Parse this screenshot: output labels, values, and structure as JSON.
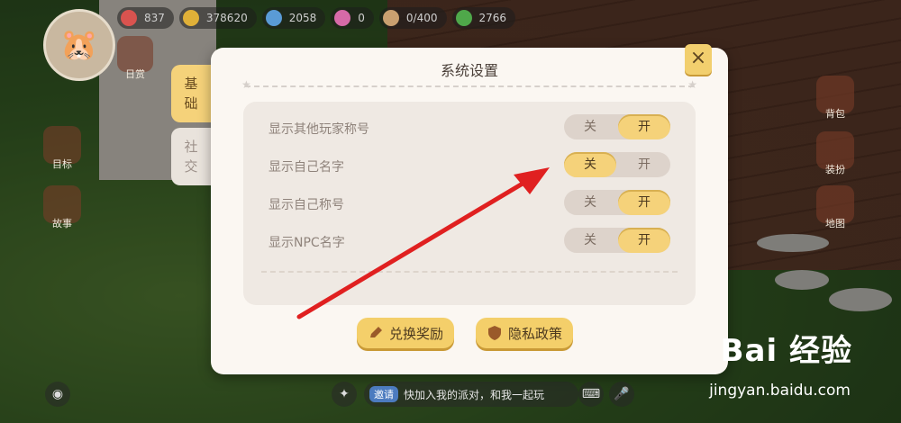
{
  "resources": [
    {
      "icon": "heart-icon",
      "value": "837",
      "color": "#d9534f"
    },
    {
      "icon": "coin-icon",
      "value": "378620",
      "color": "#e0b038"
    },
    {
      "icon": "potion-icon",
      "value": "2058",
      "color": "#5a9bd6"
    },
    {
      "icon": "gem-icon",
      "value": "0",
      "color": "#d66aa8"
    },
    {
      "icon": "hamster-icon",
      "value": "0/400",
      "color": "#c9a070"
    },
    {
      "icon": "clover-icon",
      "value": "2766",
      "color": "#4fa84a"
    }
  ],
  "side_left": [
    {
      "label": "目标"
    },
    {
      "label": "故事"
    }
  ],
  "side_top_left": [
    {
      "label": "日赏"
    }
  ],
  "side_right": [
    {
      "label": "背包"
    },
    {
      "label": "装扮"
    },
    {
      "label": "地图"
    }
  ],
  "modal": {
    "title": "系统设置",
    "close_label": "×",
    "tabs": [
      {
        "label": "基础",
        "active": true
      },
      {
        "label": "社交",
        "active": false
      }
    ],
    "settings": [
      {
        "label": "显示其他玩家称号",
        "off": "关",
        "on": "开",
        "state": "on"
      },
      {
        "label": "显示自己名字",
        "off": "关",
        "on": "开",
        "state": "off"
      },
      {
        "label": "显示自己称号",
        "off": "关",
        "on": "开",
        "state": "on"
      },
      {
        "label": "显示NPC名字",
        "off": "关",
        "on": "开",
        "state": "on"
      }
    ],
    "buttons": [
      {
        "label": "兑换奖励",
        "icon": "pencil-icon"
      },
      {
        "label": "隐私政策",
        "icon": "shield-icon"
      }
    ]
  },
  "chat": {
    "tag": "邀请",
    "text": "快加入我的派对，和我一起玩"
  },
  "watermark": {
    "brand": "Bai 经验",
    "url": "jingyan.baidu.com"
  },
  "colors": {
    "accent": "#f5d27a",
    "modal_bg": "#fbf7f2",
    "panel_bg": "#efe9e3",
    "arrow": "#e02020"
  }
}
